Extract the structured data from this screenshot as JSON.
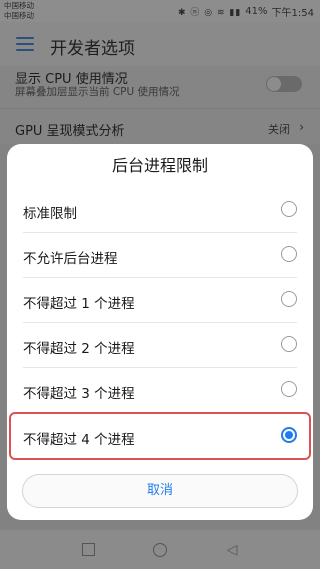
{
  "status_bar": {
    "carrier_1": "中国移动",
    "carrier_2": "中国移动",
    "icons": "✱ ⓝ ◎ ≋ ▮▮",
    "battery": "41%",
    "time": "下午1:54"
  },
  "app_bar": {
    "title": "开发者选项",
    "menu_icon": "hamburger-menu"
  },
  "settings": {
    "cpu_usage_title": "显示 CPU 使用情况",
    "cpu_usage_sub": "屏幕叠加层显示当前 CPU 使用情况",
    "gpu_title": "GPU 呈现模式分析",
    "gpu_value": "关闭"
  },
  "dialog": {
    "title": "后台进程限制",
    "options": [
      {
        "label": "标准限制",
        "selected": false
      },
      {
        "label": "不允许后台进程",
        "selected": false
      },
      {
        "label": "不得超过 1 个进程",
        "selected": false
      },
      {
        "label": "不得超过 2 个进程",
        "selected": false
      },
      {
        "label": "不得超过 3 个进程",
        "selected": false
      },
      {
        "label": "不得超过 4 个进程",
        "selected": true
      }
    ],
    "cancel_label": "取消",
    "accent_color": "#1e7cf0",
    "highlight_color": "#e05050"
  },
  "nav_bar": {
    "recent_icon": "square-icon",
    "home_icon": "circle-icon",
    "back_icon": "triangle-back-icon"
  }
}
